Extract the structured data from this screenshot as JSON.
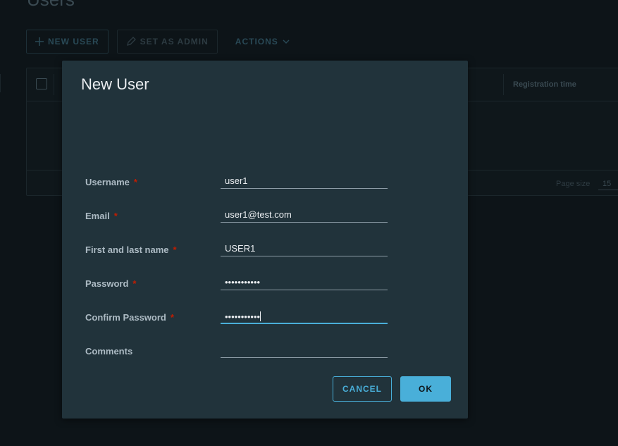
{
  "page": {
    "title": "Users",
    "toolbar": {
      "new_user": "NEW USER",
      "set_as_admin": "SET AS ADMIN",
      "actions": "ACTIONS"
    },
    "grid": {
      "columns": [
        "Registration time"
      ],
      "page_size_label": "Page size",
      "page_size_value": "15"
    }
  },
  "modal": {
    "title": "New User",
    "fields": [
      {
        "label": "Username",
        "required": true,
        "value": "user1"
      },
      {
        "label": "Email",
        "required": true,
        "value": "user1@test.com"
      },
      {
        "label": "First and last name",
        "required": true,
        "value": "USER1"
      },
      {
        "label": "Password",
        "required": true,
        "value": "•••••••••••"
      },
      {
        "label": "Confirm Password",
        "required": true,
        "value": "•••••••••••",
        "focused": true
      },
      {
        "label": "Comments",
        "required": false,
        "value": ""
      }
    ],
    "required_mark": "*",
    "cancel_label": "CANCEL",
    "ok_label": "OK"
  },
  "colors": {
    "accent": "#49afd9",
    "required": "#c21d00",
    "modal_bg": "#21333b"
  }
}
